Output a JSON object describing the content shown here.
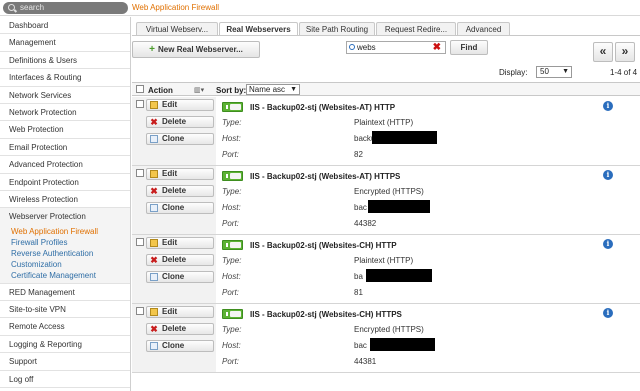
{
  "topbar": {
    "search_placeholder": "search",
    "page_title": "Web Application Firewall"
  },
  "sidebar": {
    "items_top": [
      "Dashboard",
      "Management",
      "Definitions & Users",
      "Interfaces & Routing",
      "Network Services",
      "Network Protection",
      "Web Protection",
      "Email Protection",
      "Advanced Protection",
      "Endpoint Protection",
      "Wireless Protection"
    ],
    "active_section": "Webserver Protection",
    "sub_items": [
      "Web Application Firewall",
      "Firewall Profiles",
      "Reverse Authentication",
      "Customization",
      "Certificate Management"
    ],
    "items_bottom": [
      "RED Management",
      "Site-to-site VPN",
      "Remote Access",
      "Logging & Reporting",
      "Support",
      "Log off"
    ]
  },
  "tabs": [
    "Virtual Webserv...",
    "Real Webservers",
    "Site Path Routing",
    "Request Redire...",
    "Advanced"
  ],
  "toolbar": {
    "new_button": "New Real Webserver...",
    "filter_value": "webs",
    "clear_icon": "✖",
    "find_button": "Find",
    "prev_glyph": "«",
    "next_glyph": "»",
    "display_label": "Display:",
    "display_value": "50",
    "range_text": "1-4 of 4"
  },
  "table_header": {
    "action": "Action",
    "sort_label": "Sort by:",
    "sort_value": "Name asc"
  },
  "row_actions": {
    "edit": "Edit",
    "delete": "Delete",
    "clone": "Clone"
  },
  "field_labels": {
    "type": "Type:",
    "host": "Host:",
    "port": "Port:"
  },
  "rows": [
    {
      "title": "IIS - Backup02-stj (Websites-AT) HTTP",
      "type": "Plaintext (HTTP)",
      "host": "backu",
      "port": "82",
      "enabled": true
    },
    {
      "title": "IIS - Backup02-stj (Websites-AT) HTTPS",
      "type": "Encrypted (HTTPS)",
      "host": "bac",
      "port": "44382",
      "enabled": true
    },
    {
      "title": "IIS - Backup02-stj (Websites-CH) HTTP",
      "type": "Plaintext (HTTP)",
      "host": "ba",
      "port": "81",
      "enabled": true
    },
    {
      "title": "IIS - Backup02-stj (Websites-CH) HTTPS",
      "type": "Encrypted (HTTPS)",
      "host": "bac",
      "port": "44381",
      "enabled": true
    }
  ],
  "colors": {
    "accent": "#e07000",
    "link": "#2f6ea6",
    "toggle_on": "#5cb234",
    "info": "#2a6dbd"
  }
}
